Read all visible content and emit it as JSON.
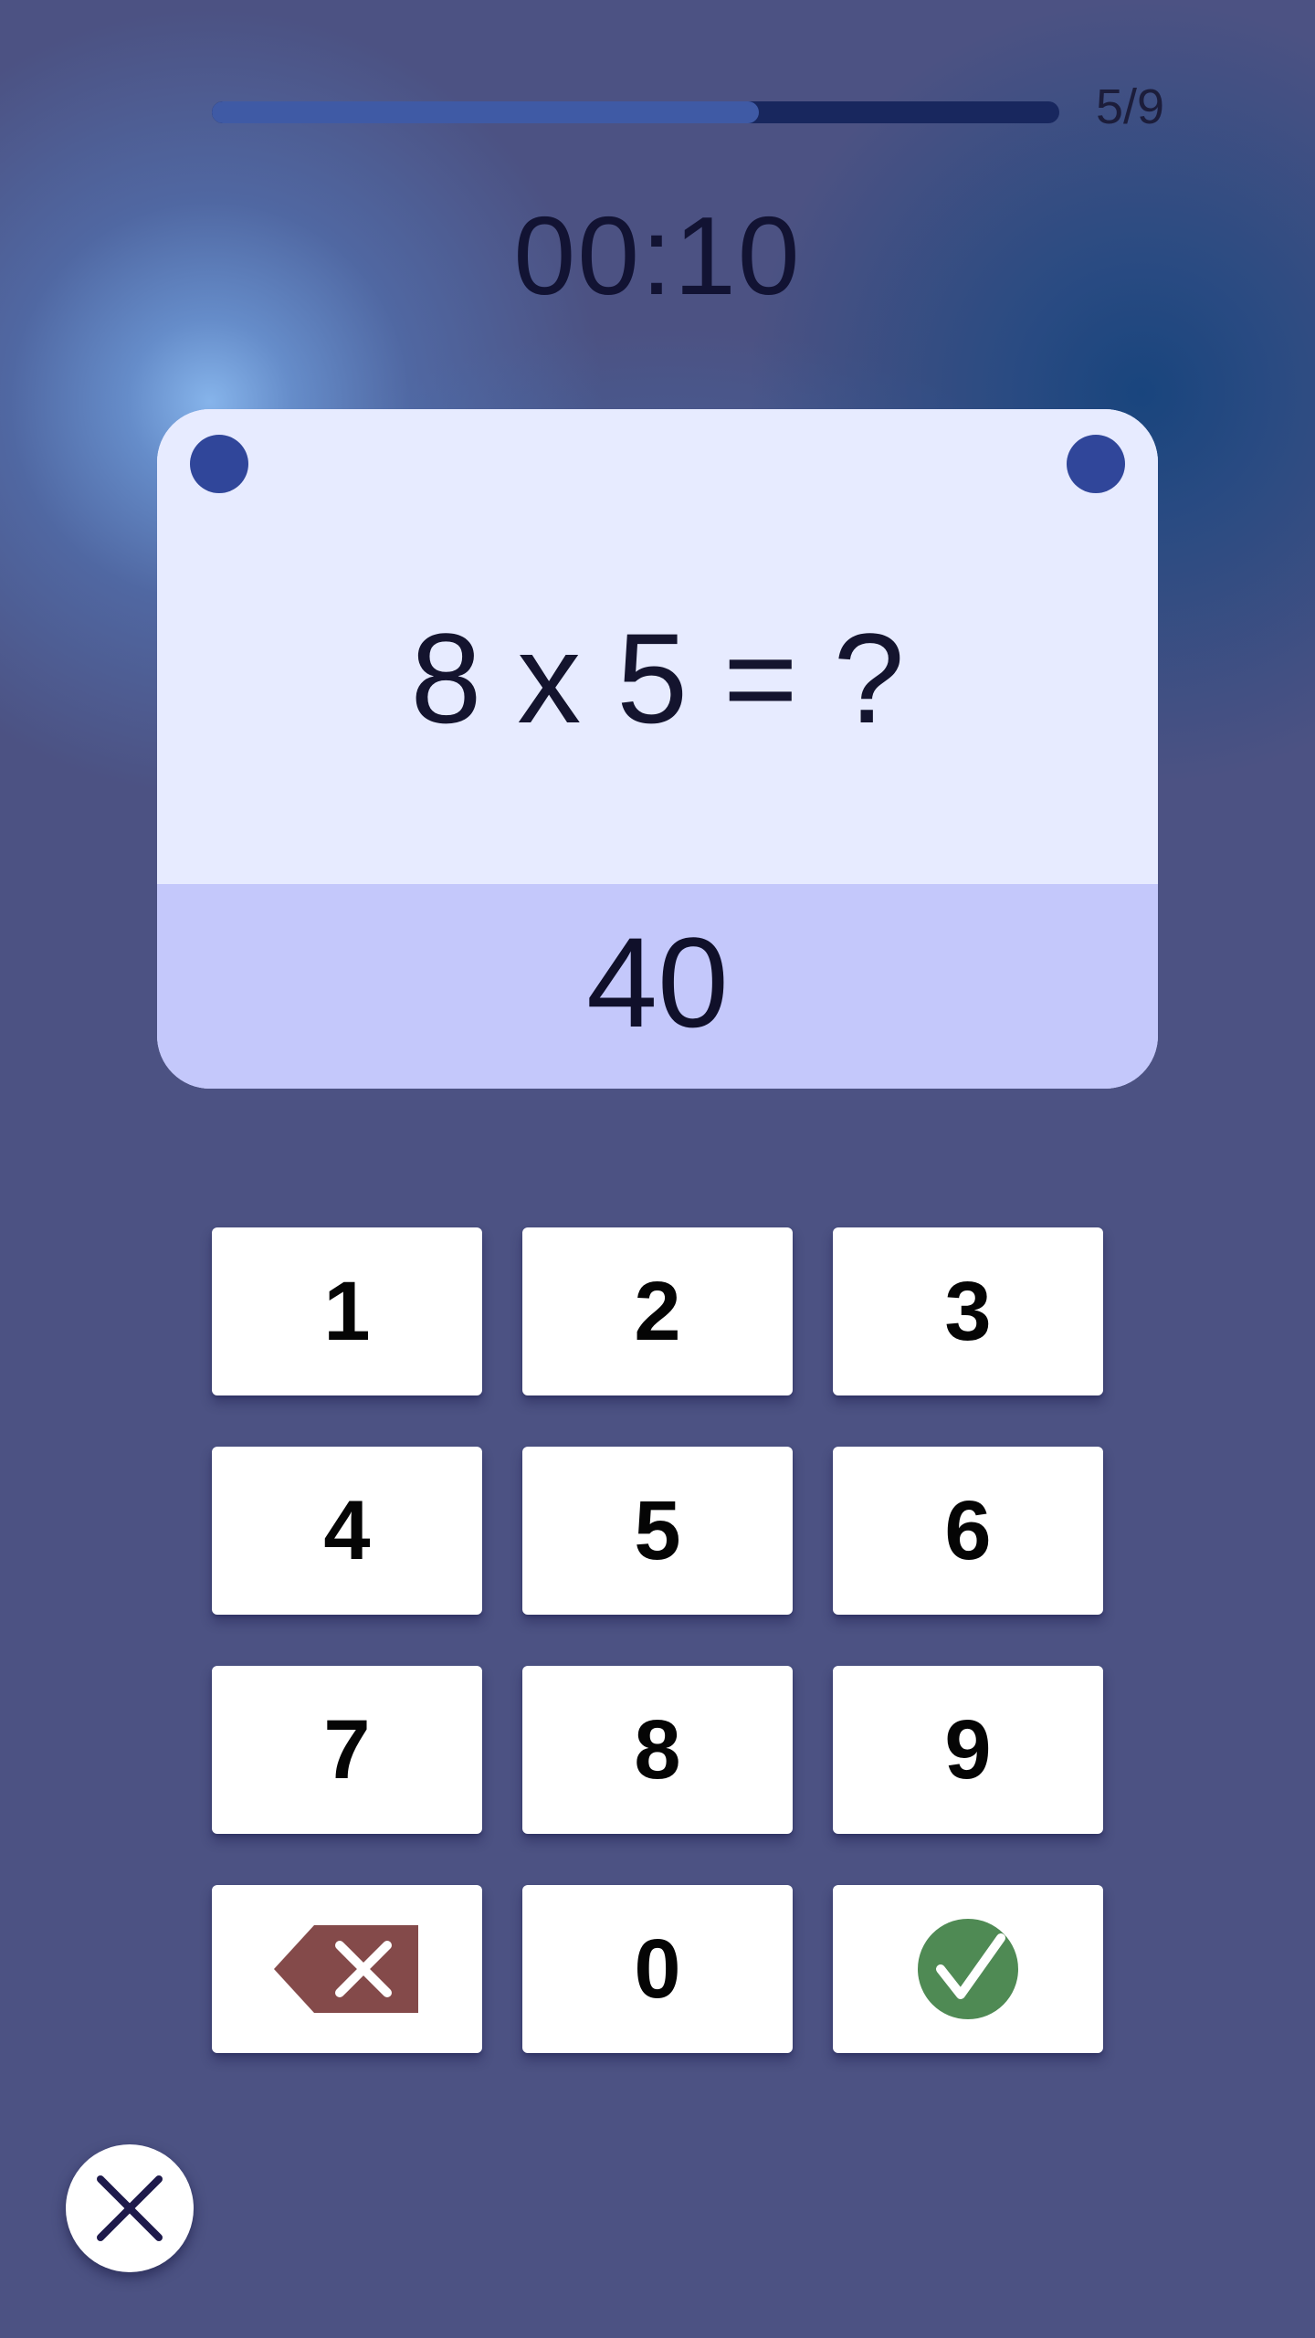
{
  "progress": {
    "label": "5/9",
    "fraction": 0.645
  },
  "timer": {
    "text": "00:10"
  },
  "question": {
    "text": "8 x 5 = ?",
    "answer": "40"
  },
  "keypad": {
    "keys": [
      "1",
      "2",
      "3",
      "4",
      "5",
      "6",
      "7",
      "8",
      "9",
      "",
      "0",
      ""
    ],
    "backspace_icon": "backspace-icon",
    "confirm_icon": "checkmark-icon"
  },
  "close": {
    "icon": "close-icon"
  },
  "colors": {
    "background": "#4c5283",
    "progress_fill": "#3f5aa5",
    "progress_track": "#18275e",
    "card": "#e7ebff",
    "answer_strip": "#c4c8fb",
    "pin": "#30469a",
    "backspace": "#844a4a",
    "confirm": "#4f8a54",
    "close_x": "#1e1a4b"
  }
}
